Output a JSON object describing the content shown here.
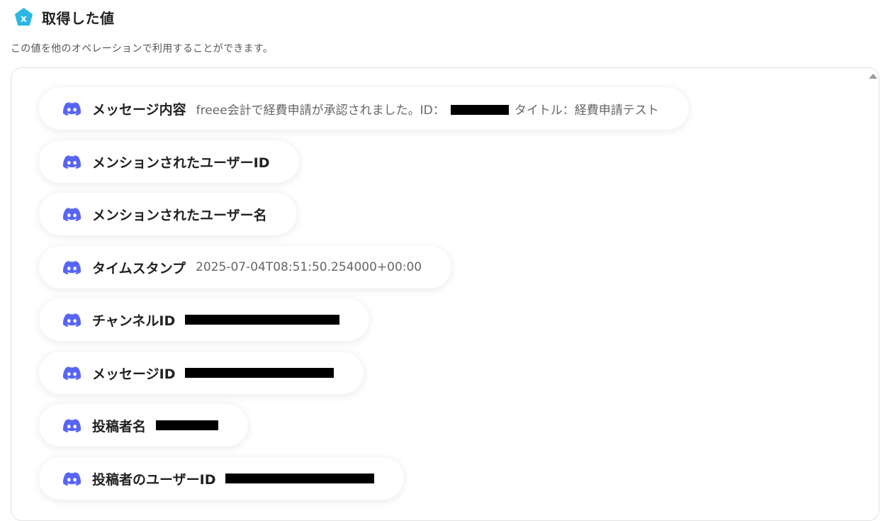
{
  "header": {
    "title": "取得した値",
    "icon": "yoom-pentagon-icon",
    "icon_color": "#2bb7e0"
  },
  "subtitle": "この値を他のオペレーションで利用することができます。",
  "discord_color": "#5865f2",
  "items": [
    {
      "label": "メッセージ内容",
      "value_prefix": "freee会計で経費申請が承認されました。ID：",
      "value_suffix": "タイトル：経費申請テスト",
      "redacted": true
    },
    {
      "label": "メンションされたユーザーID",
      "value": ""
    },
    {
      "label": "メンションされたユーザー名",
      "value": ""
    },
    {
      "label": "タイムスタンプ",
      "value": "2025-07-04T08:51:50.254000+00:00"
    },
    {
      "label": "チャンネルID",
      "redacted": true
    },
    {
      "label": "メッセージID",
      "redacted": true
    },
    {
      "label": "投稿者名",
      "redacted": true
    },
    {
      "label": "投稿者のユーザーID",
      "redacted": true
    }
  ]
}
